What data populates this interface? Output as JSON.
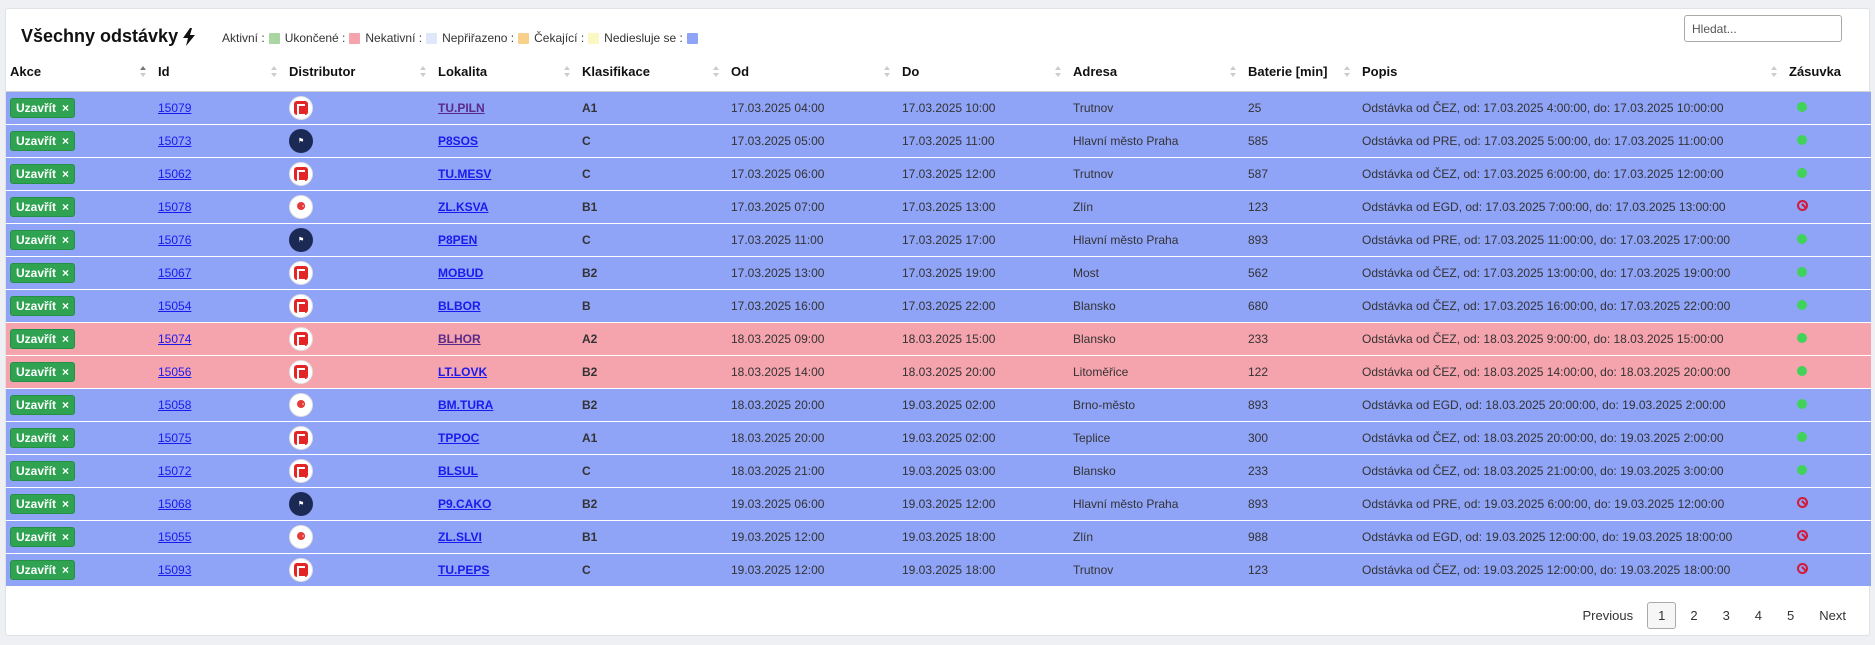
{
  "header": {
    "title": "Všechny odstávky",
    "search_placeholder": "Hledat..."
  },
  "legend": [
    {
      "label": "Aktivní :",
      "color": "#a8d5a0"
    },
    {
      "label": "Ukončené :",
      "color": "#f5a3ad"
    },
    {
      "label": "Nekativní :",
      "color": "#dfe8fb"
    },
    {
      "label": "Nepřiřazeno :",
      "color": "#f8d08a"
    },
    {
      "label": "Čekající :",
      "color": "#fbf7c2"
    },
    {
      "label": "Nediesluje se :",
      "color": "#8fa3f7"
    }
  ],
  "columns": [
    "Akce",
    "Id",
    "Distributor",
    "Lokalita",
    "Klasifikace",
    "Od",
    "Do",
    "Adresa",
    "Baterie [min]",
    "Popis",
    "Zásuvka"
  ],
  "close_label": "Uzavřít",
  "close_x": "×",
  "rows": [
    {
      "id": "15079",
      "dist": "cez",
      "lokalita": "TU.PILN",
      "cls": "A1",
      "od": "17.03.2025 04:00",
      "do": "17.03.2025 10:00",
      "adresa": "Trutnov",
      "baterie": "25",
      "popis": "Odstávka od ČEZ, od: 17.03.2025 4:00:00, do: 17.03.2025 10:00:00",
      "zasuvka": "ok",
      "status": "blue",
      "visited": true
    },
    {
      "id": "15073",
      "dist": "pre",
      "lokalita": "P8SOS",
      "cls": "C",
      "od": "17.03.2025 05:00",
      "do": "17.03.2025 11:00",
      "adresa": "Hlavní město Praha",
      "baterie": "585",
      "popis": "Odstávka od PRE, od: 17.03.2025 5:00:00, do: 17.03.2025 11:00:00",
      "zasuvka": "ok",
      "status": "blue",
      "visited": false
    },
    {
      "id": "15062",
      "dist": "cez",
      "lokalita": "TU.MESV",
      "cls": "C",
      "od": "17.03.2025 06:00",
      "do": "17.03.2025 12:00",
      "adresa": "Trutnov",
      "baterie": "587",
      "popis": "Odstávka od ČEZ, od: 17.03.2025 6:00:00, do: 17.03.2025 12:00:00",
      "zasuvka": "ok",
      "status": "blue",
      "visited": false
    },
    {
      "id": "15078",
      "dist": "egd",
      "lokalita": "ZL.KSVA",
      "cls": "B1",
      "od": "17.03.2025 07:00",
      "do": "17.03.2025 13:00",
      "adresa": "Zlín",
      "baterie": "123",
      "popis": "Odstávka od EGD, od: 17.03.2025 7:00:00, do: 17.03.2025 13:00:00",
      "zasuvka": "ban",
      "status": "blue",
      "visited": false
    },
    {
      "id": "15076",
      "dist": "pre",
      "lokalita": "P8PEN",
      "cls": "C",
      "od": "17.03.2025 11:00",
      "do": "17.03.2025 17:00",
      "adresa": "Hlavní město Praha",
      "baterie": "893",
      "popis": "Odstávka od PRE, od: 17.03.2025 11:00:00, do: 17.03.2025 17:00:00",
      "zasuvka": "ok",
      "status": "blue",
      "visited": false
    },
    {
      "id": "15067",
      "dist": "cez",
      "lokalita": "MOBUD",
      "cls": "B2",
      "od": "17.03.2025 13:00",
      "do": "17.03.2025 19:00",
      "adresa": "Most",
      "baterie": "562",
      "popis": "Odstávka od ČEZ, od: 17.03.2025 13:00:00, do: 17.03.2025 19:00:00",
      "zasuvka": "ok",
      "status": "blue",
      "visited": false
    },
    {
      "id": "15054",
      "dist": "cez",
      "lokalita": "BLBOR",
      "cls": "B",
      "od": "17.03.2025 16:00",
      "do": "17.03.2025 22:00",
      "adresa": "Blansko",
      "baterie": "680",
      "popis": "Odstávka od ČEZ, od: 17.03.2025 16:00:00, do: 17.03.2025 22:00:00",
      "zasuvka": "ok",
      "status": "blue",
      "visited": false
    },
    {
      "id": "15074",
      "dist": "cez",
      "lokalita": "BLHOR",
      "cls": "A2",
      "od": "18.03.2025 09:00",
      "do": "18.03.2025 15:00",
      "adresa": "Blansko",
      "baterie": "233",
      "popis": "Odstávka od ČEZ, od: 18.03.2025 9:00:00, do: 18.03.2025 15:00:00",
      "zasuvka": "ok",
      "status": "red",
      "visited": true
    },
    {
      "id": "15056",
      "dist": "cez",
      "lokalita": "LT.LOVK",
      "cls": "B2",
      "od": "18.03.2025 14:00",
      "do": "18.03.2025 20:00",
      "adresa": "Litoměřice",
      "baterie": "122",
      "popis": "Odstávka od ČEZ, od: 18.03.2025 14:00:00, do: 18.03.2025 20:00:00",
      "zasuvka": "ok",
      "status": "red",
      "visited": false
    },
    {
      "id": "15058",
      "dist": "egd",
      "lokalita": "BM.TURA",
      "cls": "B2",
      "od": "18.03.2025 20:00",
      "do": "19.03.2025 02:00",
      "adresa": "Brno-město",
      "baterie": "893",
      "popis": "Odstávka od EGD, od: 18.03.2025 20:00:00, do: 19.03.2025 2:00:00",
      "zasuvka": "ok",
      "status": "blue",
      "visited": false
    },
    {
      "id": "15075",
      "dist": "cez",
      "lokalita": "TPPOC",
      "cls": "A1",
      "od": "18.03.2025 20:00",
      "do": "19.03.2025 02:00",
      "adresa": "Teplice",
      "baterie": "300",
      "popis": "Odstávka od ČEZ, od: 18.03.2025 20:00:00, do: 19.03.2025 2:00:00",
      "zasuvka": "ok",
      "status": "blue",
      "visited": false
    },
    {
      "id": "15072",
      "dist": "cez",
      "lokalita": "BLSUL",
      "cls": "C",
      "od": "18.03.2025 21:00",
      "do": "19.03.2025 03:00",
      "adresa": "Blansko",
      "baterie": "233",
      "popis": "Odstávka od ČEZ, od: 18.03.2025 21:00:00, do: 19.03.2025 3:00:00",
      "zasuvka": "ok",
      "status": "blue",
      "visited": false
    },
    {
      "id": "15068",
      "dist": "pre",
      "lokalita": "P9.CAKO",
      "cls": "B2",
      "od": "19.03.2025 06:00",
      "do": "19.03.2025 12:00",
      "adresa": "Hlavní město Praha",
      "baterie": "893",
      "popis": "Odstávka od PRE, od: 19.03.2025 6:00:00, do: 19.03.2025 12:00:00",
      "zasuvka": "ban",
      "status": "blue",
      "visited": false
    },
    {
      "id": "15055",
      "dist": "egd",
      "lokalita": "ZL.SLVI",
      "cls": "B1",
      "od": "19.03.2025 12:00",
      "do": "19.03.2025 18:00",
      "adresa": "Zlín",
      "baterie": "988",
      "popis": "Odstávka od EGD, od: 19.03.2025 12:00:00, do: 19.03.2025 18:00:00",
      "zasuvka": "ban",
      "status": "blue",
      "visited": false
    },
    {
      "id": "15093",
      "dist": "cez",
      "lokalita": "TU.PEPS",
      "cls": "C",
      "od": "19.03.2025 12:00",
      "do": "19.03.2025 18:00",
      "adresa": "Trutnov",
      "baterie": "123",
      "popis": "Odstávka od ČEZ, od: 19.03.2025 12:00:00, do: 19.03.2025 18:00:00",
      "zasuvka": "ban",
      "status": "blue",
      "visited": false
    }
  ],
  "pagination": {
    "previous": "Previous",
    "pages": [
      "1",
      "2",
      "3",
      "4",
      "5"
    ],
    "current": "1",
    "next": "Next"
  }
}
